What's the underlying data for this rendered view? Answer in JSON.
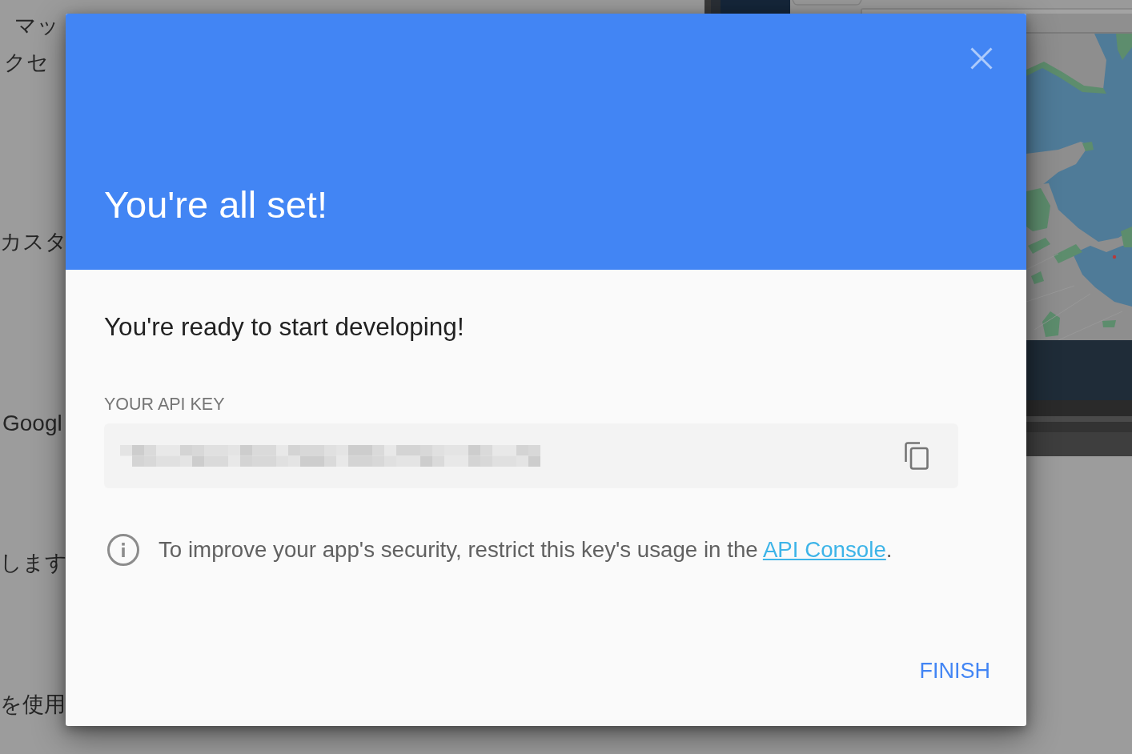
{
  "background_page": {
    "lines": [
      "マッ",
      "クセ",
      "カスタ",
      "Googl",
      "します",
      "を使用"
    ]
  },
  "dialog": {
    "title": "You're all set!",
    "message": "You're ready to start developing!",
    "api_key": {
      "label": "YOUR API KEY"
    },
    "notice": {
      "text": "To improve your app's security, restrict this key's usage in the ",
      "link": "API Console",
      "after_link": "."
    },
    "buttons": [
      {
        "label": "FINISH"
      }
    ]
  }
}
